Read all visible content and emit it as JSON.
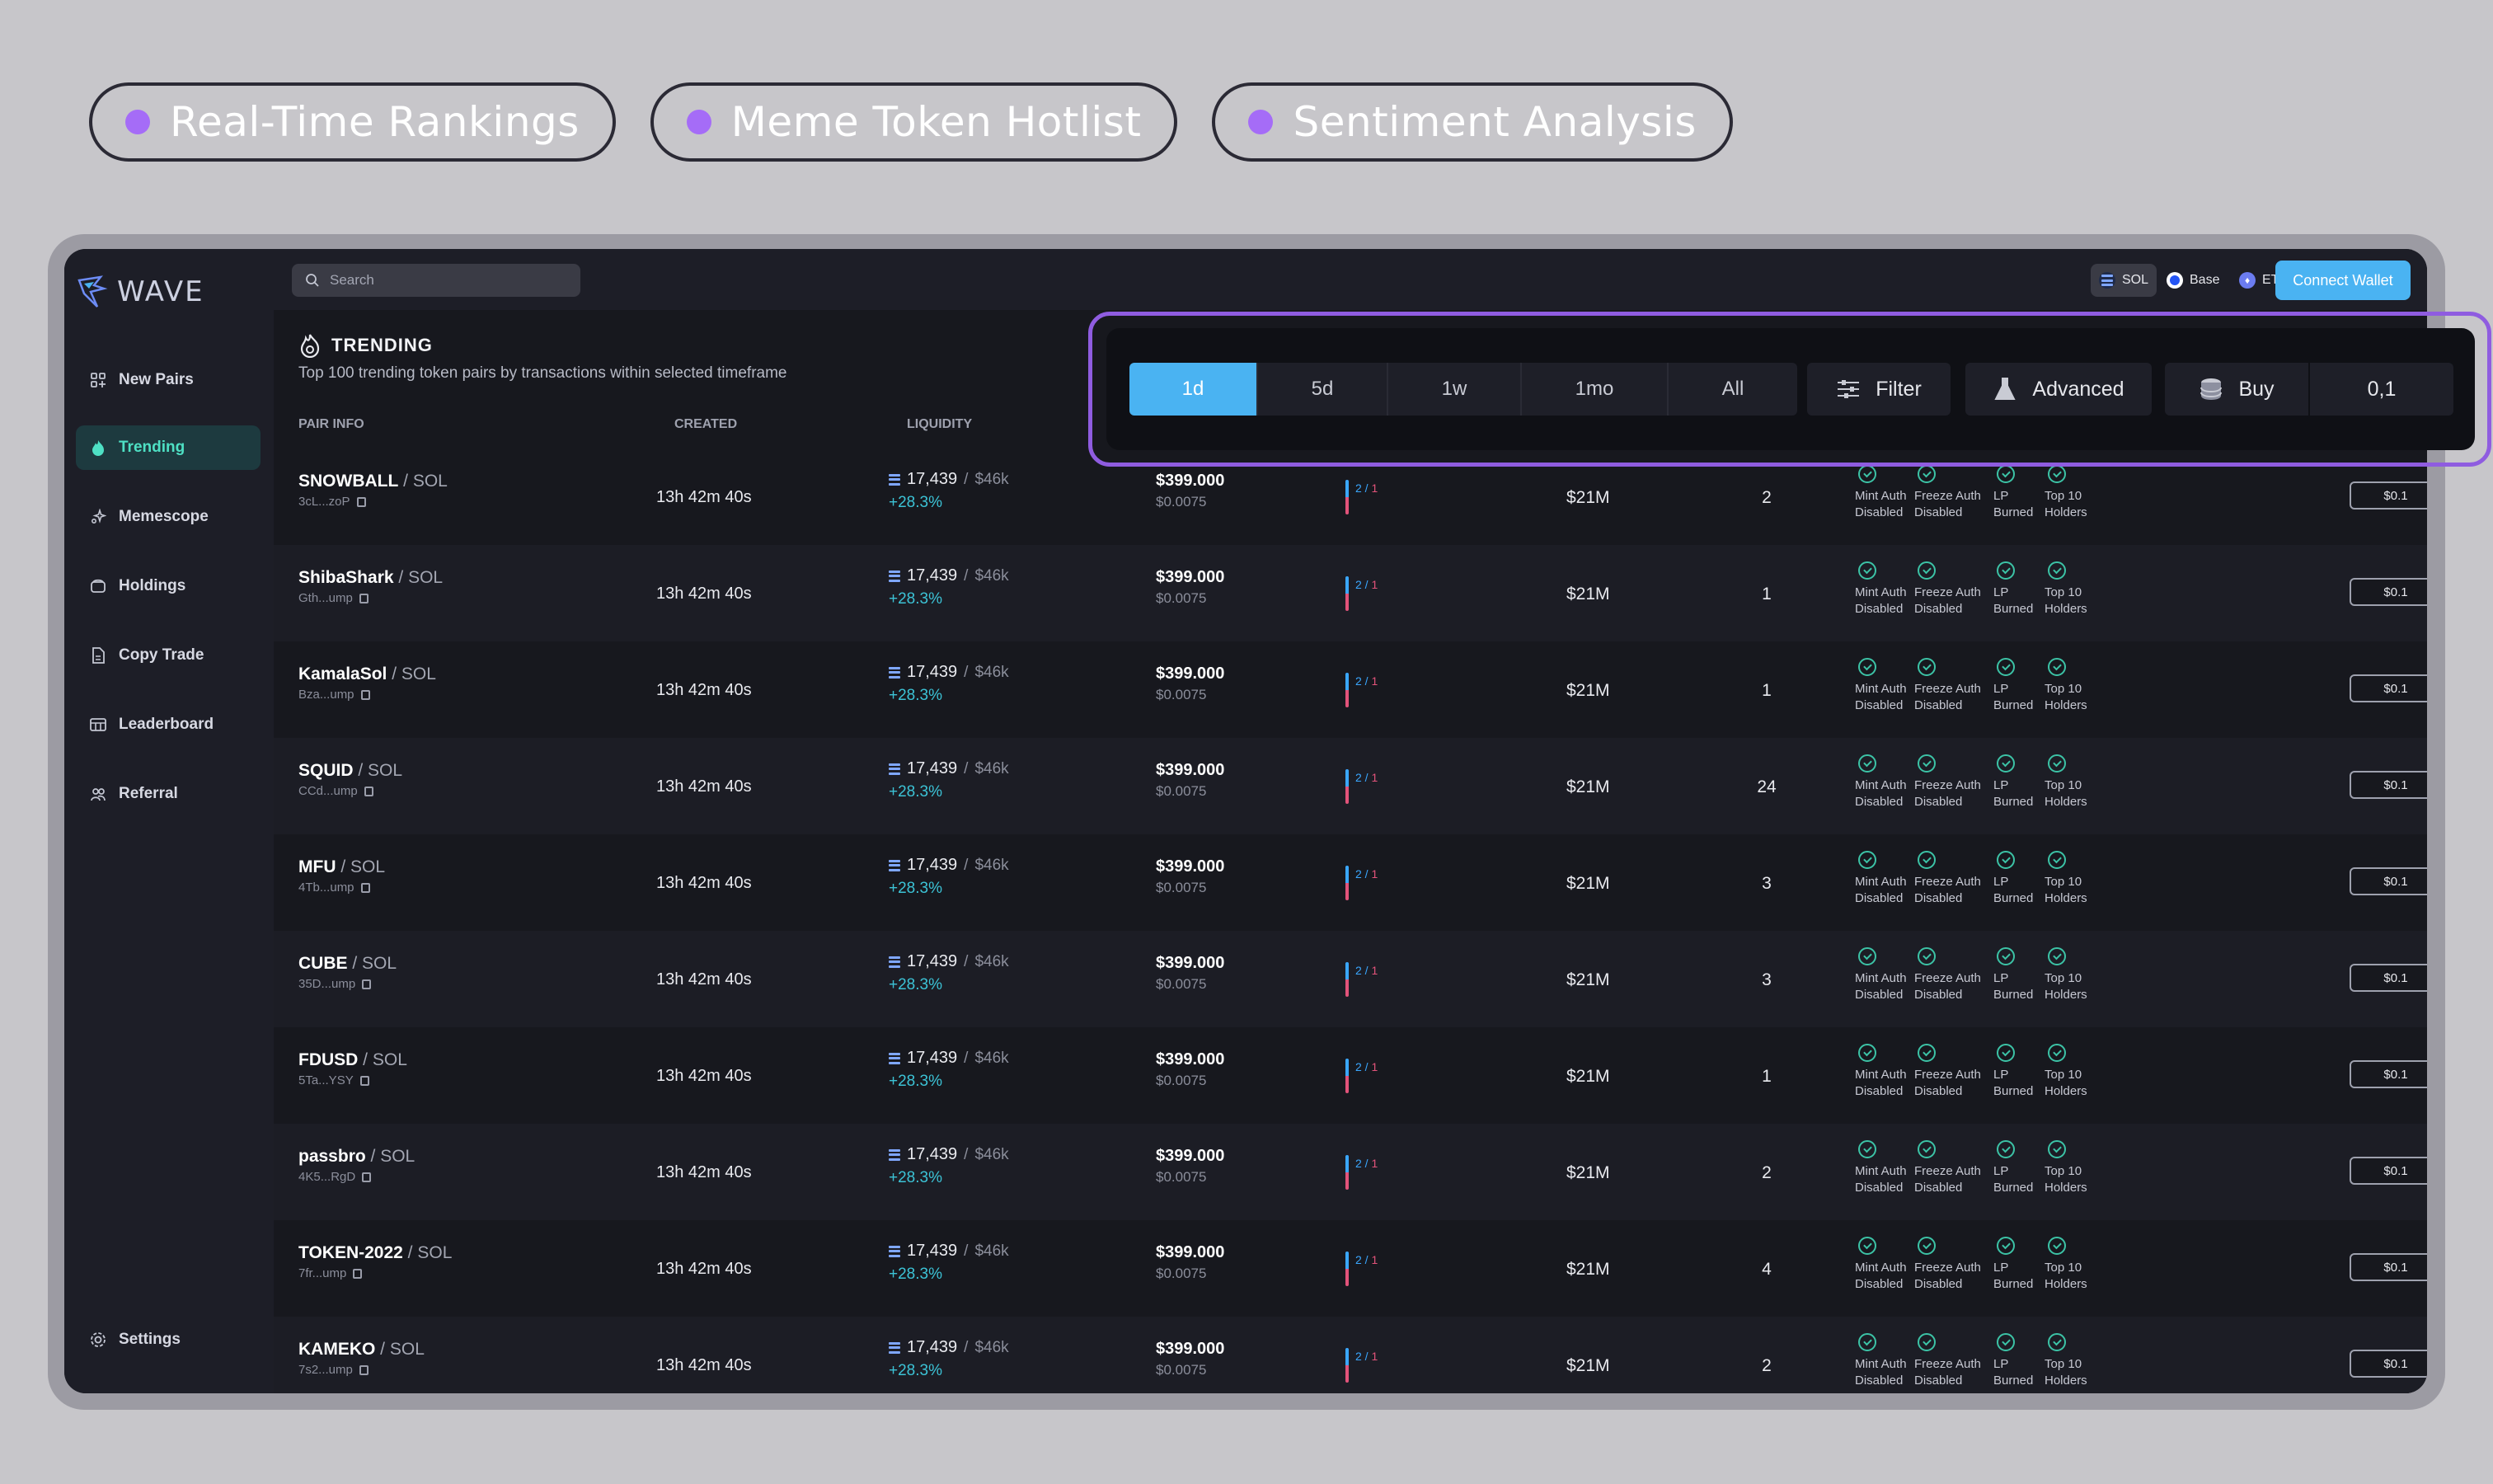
{
  "pills": [
    "Real-Time Rankings",
    "Meme Token Hotlist",
    "Sentiment Analysis"
  ],
  "brand": {
    "name": "WAVE"
  },
  "sidebar": {
    "items": [
      {
        "label": "New Pairs",
        "icon": "grid-icon"
      },
      {
        "label": "Trending",
        "icon": "flame-icon",
        "active": true
      },
      {
        "label": "Memescope",
        "icon": "sparkle-icon"
      },
      {
        "label": "Holdings",
        "icon": "wallet-icon"
      },
      {
        "label": "Copy Trade",
        "icon": "document-icon"
      },
      {
        "label": "Leaderboard",
        "icon": "table-icon"
      },
      {
        "label": "Referral",
        "icon": "people-icon"
      }
    ],
    "settings_label": "Settings"
  },
  "topbar": {
    "search_placeholder": "Search",
    "chains": [
      "SOL",
      "Base",
      "ETH"
    ],
    "selected_chain": "SOL",
    "connect_label": "Connect Wallet"
  },
  "trending": {
    "title": "TRENDING",
    "subtitle": "Top 100 trending token pairs by transactions within selected timeframe"
  },
  "columns": {
    "pair_info": "PAIR INFO",
    "created": "CREATED",
    "liquidity": "LIQUIDITY"
  },
  "filters": {
    "timeframes": [
      "1d",
      "5d",
      "1w",
      "1mo",
      "All"
    ],
    "active_timeframe": "1d",
    "filter_label": "Filter",
    "advanced_label": "Advanced",
    "buy_label": "Buy",
    "buy_amount": "0,1"
  },
  "audit_labels": [
    [
      "Mint Auth",
      "Disabled"
    ],
    [
      "Freeze Auth",
      "Disabled"
    ],
    [
      "LP",
      "Burned"
    ],
    [
      "Top 10",
      "Holders"
    ]
  ],
  "rows": [
    {
      "symbol": "SNOWBALL",
      "quote": "SOL",
      "address": "3cL...zoP",
      "created": "13h 42m 40s",
      "liquidity": "17,439",
      "mcap": "$46k",
      "change": "+28.3%",
      "price": "$399.000",
      "price_sol": "$0.0075",
      "txns_buy": "2",
      "txns_sell": "1",
      "volume": "$21M",
      "holders": "2",
      "buy": "$0.1"
    },
    {
      "symbol": "ShibaShark",
      "quote": "SOL",
      "address": "Gth...ump",
      "created": "13h 42m 40s",
      "liquidity": "17,439",
      "mcap": "$46k",
      "change": "+28.3%",
      "price": "$399.000",
      "price_sol": "$0.0075",
      "txns_buy": "2",
      "txns_sell": "1",
      "volume": "$21M",
      "holders": "1",
      "buy": "$0.1"
    },
    {
      "symbol": "KamalaSol",
      "quote": "SOL",
      "address": "Bza...ump",
      "created": "13h 42m 40s",
      "liquidity": "17,439",
      "mcap": "$46k",
      "change": "+28.3%",
      "price": "$399.000",
      "price_sol": "$0.0075",
      "txns_buy": "2",
      "txns_sell": "1",
      "volume": "$21M",
      "holders": "1",
      "buy": "$0.1"
    },
    {
      "symbol": "SQUID",
      "quote": "SOL",
      "address": "CCd...ump",
      "created": "13h 42m 40s",
      "liquidity": "17,439",
      "mcap": "$46k",
      "change": "+28.3%",
      "price": "$399.000",
      "price_sol": "$0.0075",
      "txns_buy": "2",
      "txns_sell": "1",
      "volume": "$21M",
      "holders": "24",
      "buy": "$0.1"
    },
    {
      "symbol": "MFU",
      "quote": "SOL",
      "address": "4Tb...ump",
      "created": "13h 42m 40s",
      "liquidity": "17,439",
      "mcap": "$46k",
      "change": "+28.3%",
      "price": "$399.000",
      "price_sol": "$0.0075",
      "txns_buy": "2",
      "txns_sell": "1",
      "volume": "$21M",
      "holders": "3",
      "buy": "$0.1"
    },
    {
      "symbol": "CUBE",
      "quote": "SOL",
      "address": "35D...ump",
      "created": "13h 42m 40s",
      "liquidity": "17,439",
      "mcap": "$46k",
      "change": "+28.3%",
      "price": "$399.000",
      "price_sol": "$0.0075",
      "txns_buy": "2",
      "txns_sell": "1",
      "volume": "$21M",
      "holders": "3",
      "buy": "$0.1"
    },
    {
      "symbol": "FDUSD",
      "quote": "SOL",
      "address": "5Ta...YSY",
      "created": "13h 42m 40s",
      "liquidity": "17,439",
      "mcap": "$46k",
      "change": "+28.3%",
      "price": "$399.000",
      "price_sol": "$0.0075",
      "txns_buy": "2",
      "txns_sell": "1",
      "volume": "$21M",
      "holders": "1",
      "buy": "$0.1"
    },
    {
      "symbol": "passbro",
      "quote": "SOL",
      "address": "4K5...RgD",
      "created": "13h 42m 40s",
      "liquidity": "17,439",
      "mcap": "$46k",
      "change": "+28.3%",
      "price": "$399.000",
      "price_sol": "$0.0075",
      "txns_buy": "2",
      "txns_sell": "1",
      "volume": "$21M",
      "holders": "2",
      "buy": "$0.1"
    },
    {
      "symbol": "TOKEN-2022",
      "quote": "SOL",
      "address": "7fr...ump",
      "created": "13h 42m 40s",
      "liquidity": "17,439",
      "mcap": "$46k",
      "change": "+28.3%",
      "price": "$399.000",
      "price_sol": "$0.0075",
      "txns_buy": "2",
      "txns_sell": "1",
      "volume": "$21M",
      "holders": "4",
      "buy": "$0.1"
    },
    {
      "symbol": "KAMEKO",
      "quote": "SOL",
      "address": "7s2...ump",
      "created": "13h 42m 40s",
      "liquidity": "17,439",
      "mcap": "$46k",
      "change": "+28.3%",
      "price": "$399.000",
      "price_sol": "$0.0075",
      "txns_buy": "2",
      "txns_sell": "1",
      "volume": "$21M",
      "holders": "2",
      "buy": "$0.1"
    }
  ],
  "colors": {
    "accent": "#4ab3f2",
    "active_nav": "#4ee0c4",
    "highlight": "#8f5ce0",
    "pill_dot": "#a56cf7"
  }
}
